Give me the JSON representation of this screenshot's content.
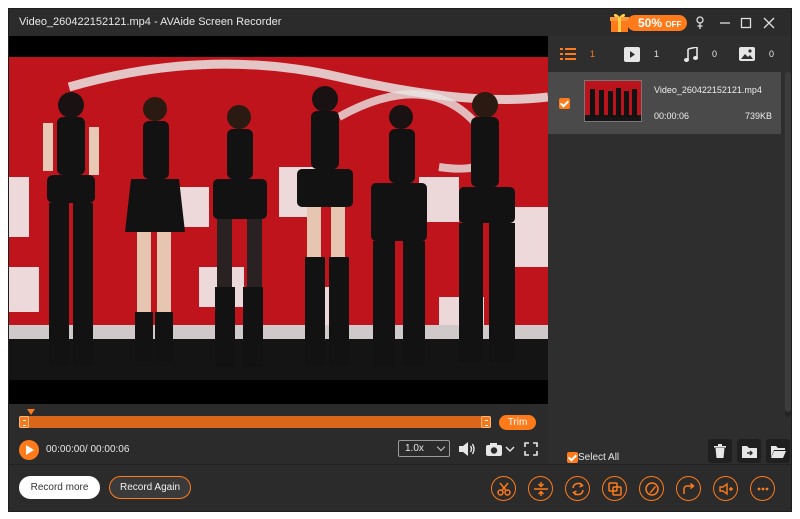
{
  "window": {
    "title": "Video_260422152121.mp4  -  AVAide Screen Recorder"
  },
  "promo": {
    "discount": "50%",
    "off": "OFF"
  },
  "colors": {
    "accent": "#ff7a1a",
    "background": "#2b2b2b",
    "stage": "#c3141d"
  },
  "titlebar_buttons": [
    "pin-icon",
    "minimize-icon",
    "maximize-icon",
    "close-icon"
  ],
  "player": {
    "time": "00:00:00/ 00:00:06",
    "speed": "1.0x",
    "trim_label": "Trim"
  },
  "tabs": [
    {
      "icon": "list-icon",
      "count": "1"
    },
    {
      "icon": "video-icon",
      "count": "1"
    },
    {
      "icon": "music-icon",
      "count": "0"
    },
    {
      "icon": "image-icon",
      "count": "0"
    }
  ],
  "files": [
    {
      "name": "Video_260422152121.mp4",
      "duration": "00:00:06",
      "size": "739KB",
      "checked": true
    }
  ],
  "panel": {
    "select_all": "Select All"
  },
  "bottom": {
    "record_more": "Record more",
    "record_again": "Record Again",
    "tools": [
      "scissors-icon",
      "split-icon",
      "convert-icon",
      "merge-icon",
      "edit-icon",
      "share-icon",
      "volume-icon",
      "more-icon"
    ]
  }
}
